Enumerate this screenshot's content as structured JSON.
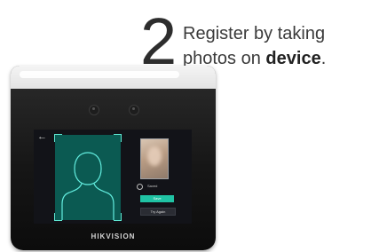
{
  "step": {
    "number": "2",
    "caption_line1": "Register by taking",
    "caption_line2_prefix": "photos on ",
    "caption_line2_bold": "device",
    "caption_line2_suffix": "."
  },
  "device": {
    "brand": "HIKVISION",
    "screen": {
      "back_icon": "back-arrow-icon",
      "status_text": "Saved",
      "save_button_label": "Save",
      "retry_button_label": "Try Again",
      "accent_color": "#20c3a4",
      "frame_color": "#0b5a52"
    }
  }
}
